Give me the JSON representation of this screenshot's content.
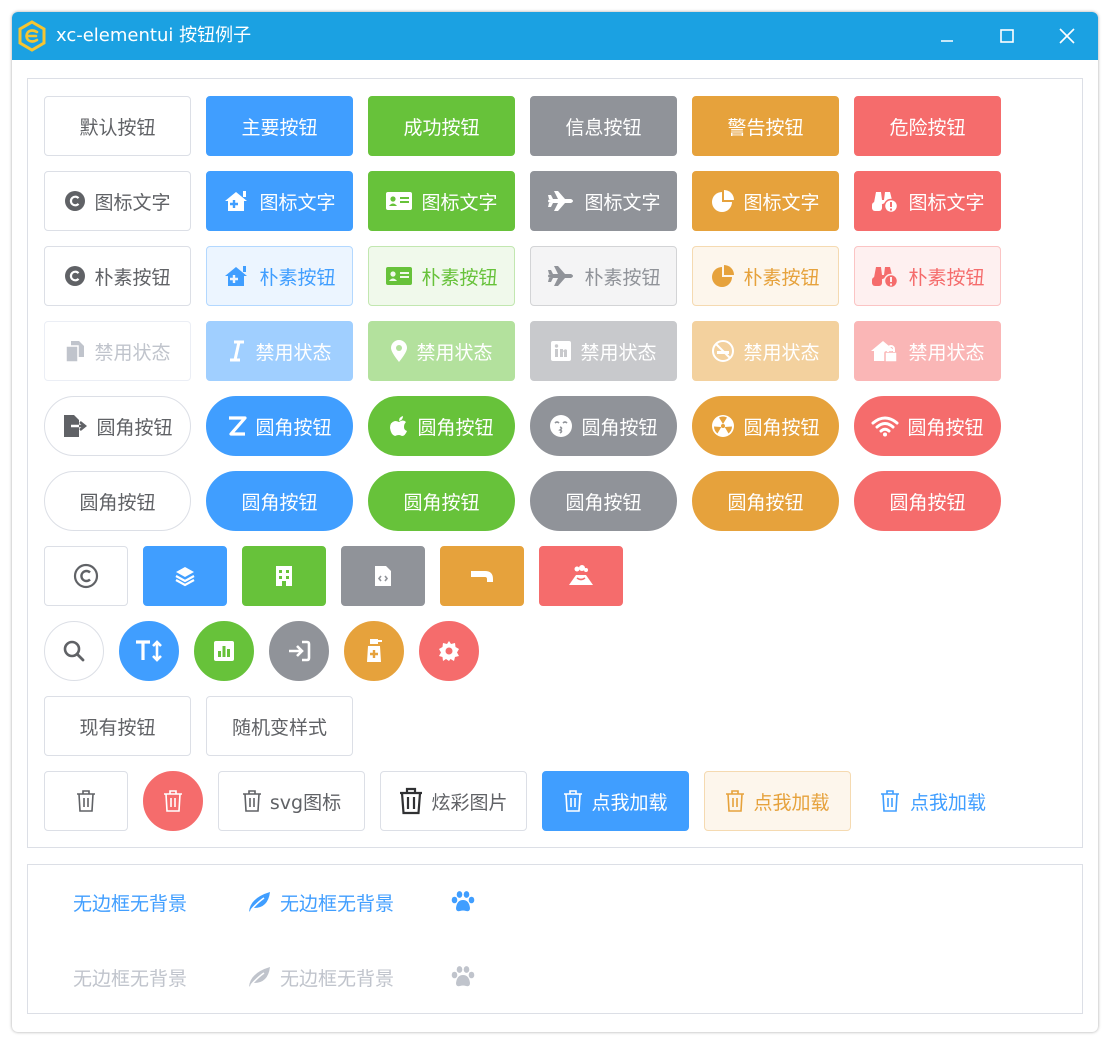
{
  "window": {
    "title": "xc-elementui 按钮例子"
  },
  "row1": [
    "默认按钮",
    "主要按钮",
    "成功按钮",
    "信息按钮",
    "警告按钮",
    "危险按钮"
  ],
  "row2": {
    "label": "图标文字",
    "icons": [
      "copyright-icon",
      "house-plus-icon",
      "id-card-icon",
      "plane-icon",
      "pie-chart-icon",
      "binoculars-alert-icon"
    ]
  },
  "row3": {
    "label": "朴素按钮",
    "icons": [
      "copyright-icon",
      "house-plus-icon",
      "id-card-icon",
      "plane-icon",
      "pie-chart-icon",
      "binoculars-alert-icon"
    ]
  },
  "row4": {
    "label": "禁用状态",
    "icons": [
      "copy-icon",
      "italic-icon",
      "map-pin-icon",
      "linkedin-icon",
      "no-smoking-icon",
      "house-lock-icon"
    ]
  },
  "row5": {
    "label": "圆角按钮",
    "icons": [
      "file-export-icon",
      "z-letter-icon",
      "apple-icon",
      "kiss-face-icon",
      "radiation-icon",
      "wifi-icon"
    ]
  },
  "row6": {
    "label": "圆角按钮"
  },
  "row7": {
    "icons": [
      "copyright-icon",
      "layers-icon",
      "building-icon",
      "file-code-icon",
      "faucet-icon",
      "volcano-icon"
    ]
  },
  "row8": {
    "icons": [
      "search-icon",
      "text-height-icon",
      "bar-chart-icon",
      "sign-in-icon",
      "spray-bottle-icon",
      "gear-icon"
    ]
  },
  "row9": [
    "现有按钮",
    "随机变样式"
  ],
  "row10": {
    "svg_label": "svg图标",
    "colorful_label": "炫彩图片",
    "load_label": "点我加载"
  },
  "bottom": {
    "text": "无边框无背景",
    "icons": [
      "leaf-icon",
      "paw-icon"
    ]
  },
  "colors": {
    "primary": "#409eff",
    "success": "#67c23a",
    "info": "#909399",
    "warning": "#e6a23c",
    "danger": "#f56c6c",
    "titlebar": "#1ba1e2"
  }
}
